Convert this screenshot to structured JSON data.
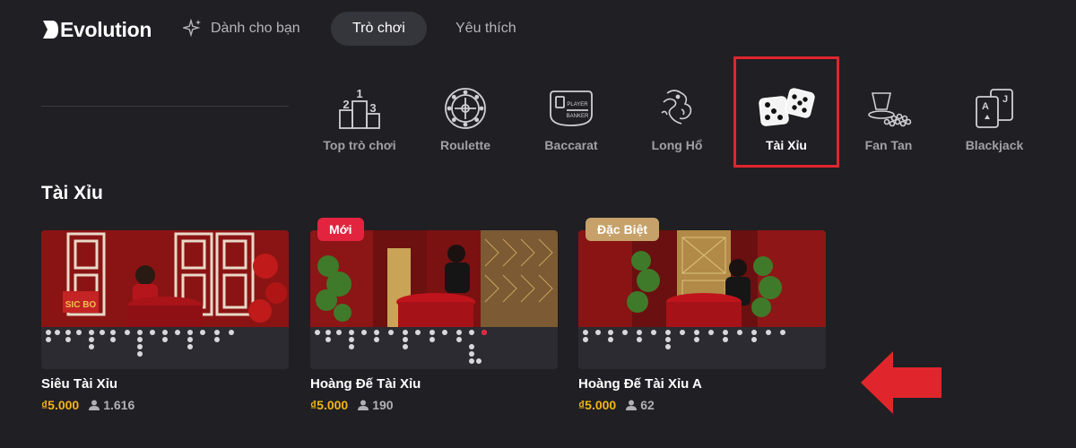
{
  "brand": {
    "name": "Evolution"
  },
  "nav": {
    "tabs": [
      {
        "label": "Dành cho bạn",
        "icon": "sparkle-icon"
      },
      {
        "label": "Trò chơi",
        "active": true
      },
      {
        "label": "Yêu thích"
      }
    ]
  },
  "categories": [
    {
      "label": "Top trò chơi",
      "icon": "podium-icon"
    },
    {
      "label": "Roulette",
      "icon": "roulette-wheel-icon"
    },
    {
      "label": "Baccarat",
      "icon": "baccarat-table-icon"
    },
    {
      "label": "Long Hổ",
      "icon": "dragon-tiger-icon"
    },
    {
      "label": "Tài Xỉu",
      "icon": "dice-icon",
      "active": true
    },
    {
      "label": "Fan Tan",
      "icon": "fan-tan-icon"
    },
    {
      "label": "Blackjack",
      "icon": "playing-cards-icon"
    }
  ],
  "section": {
    "title": "Tài Xỉu"
  },
  "games": [
    {
      "title": "Siêu Tài Xỉu",
      "price": "₫5.000",
      "players": "1.616",
      "badge": ""
    },
    {
      "title": "Hoàng Đế Tài Xỉu",
      "price": "₫5.000",
      "players": "190",
      "badge": "Mới"
    },
    {
      "title": "Hoàng Đế Tài Xỉu A",
      "price": "₫5.000",
      "players": "62",
      "badge": "Đặc Biệt"
    }
  ],
  "colors": {
    "background": "#1f1f24",
    "active_tab": "#35353c",
    "price": "#f2b518",
    "highlight": "#e0262c",
    "badge_new": "#e2243f",
    "badge_special": "#c6a16a"
  }
}
